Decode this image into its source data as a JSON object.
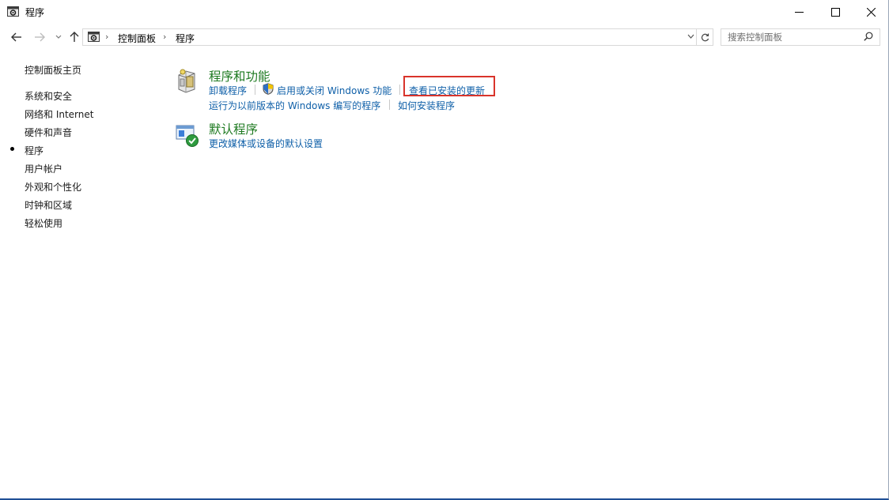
{
  "window": {
    "title": "程序"
  },
  "address": {
    "crumbs": [
      "控制面板",
      "程序"
    ]
  },
  "search": {
    "placeholder": "搜索控制面板"
  },
  "sidebar": {
    "items": [
      {
        "label": "控制面板主页"
      },
      {
        "label": "系统和安全"
      },
      {
        "label": "网络和 Internet"
      },
      {
        "label": "硬件和声音"
      },
      {
        "label": "程序",
        "current": true
      },
      {
        "label": "用户帐户"
      },
      {
        "label": "外观和个性化"
      },
      {
        "label": "时钟和区域"
      },
      {
        "label": "轻松使用"
      }
    ]
  },
  "categories": [
    {
      "title": "程序和功能",
      "icon": "programs-features-icon",
      "links": [
        "卸载程序",
        "启用或关闭 Windows 功能",
        "查看已安装的更新",
        "运行为以前版本的 Windows 编写的程序",
        "如何安装程序"
      ]
    },
    {
      "title": "默认程序",
      "icon": "default-programs-icon",
      "links": [
        "更改媒体或设备的默认设置"
      ]
    }
  ],
  "colors": {
    "category_title": "#1e7a21",
    "link": "#0e5fa8",
    "highlight_box": "#d9342b",
    "window_border": "#1f4f96"
  }
}
